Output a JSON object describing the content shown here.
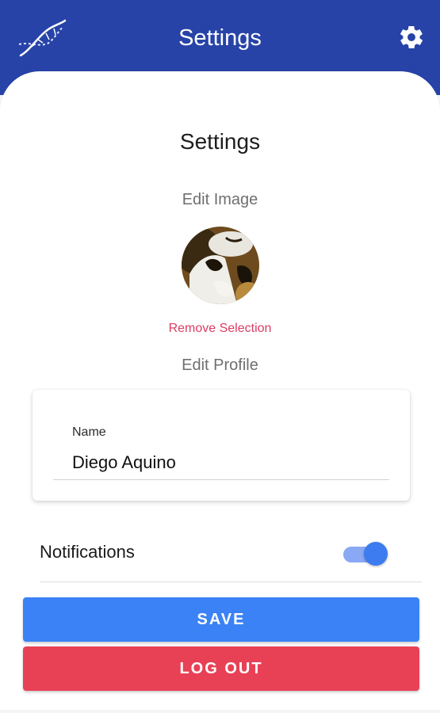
{
  "app_bar": {
    "title": "Settings",
    "logo_icon": "dna-icon",
    "settings_icon": "gear-icon",
    "color": "#2743a8"
  },
  "settings": {
    "title": "Settings",
    "edit_image_label": "Edit Image",
    "avatar_icon": "cat-photo-avatar",
    "remove_selection": "Remove Selection",
    "edit_profile_label": "Edit Profile"
  },
  "profile_form": {
    "name_label": "Name",
    "name_value": "Diego Aquino"
  },
  "notifications": {
    "label": "Notifications",
    "enabled": true
  },
  "actions": {
    "save_label": "SAVE",
    "logout_label": "LOG OUT",
    "save_color": "#3b82f6",
    "logout_color": "#e84156"
  }
}
